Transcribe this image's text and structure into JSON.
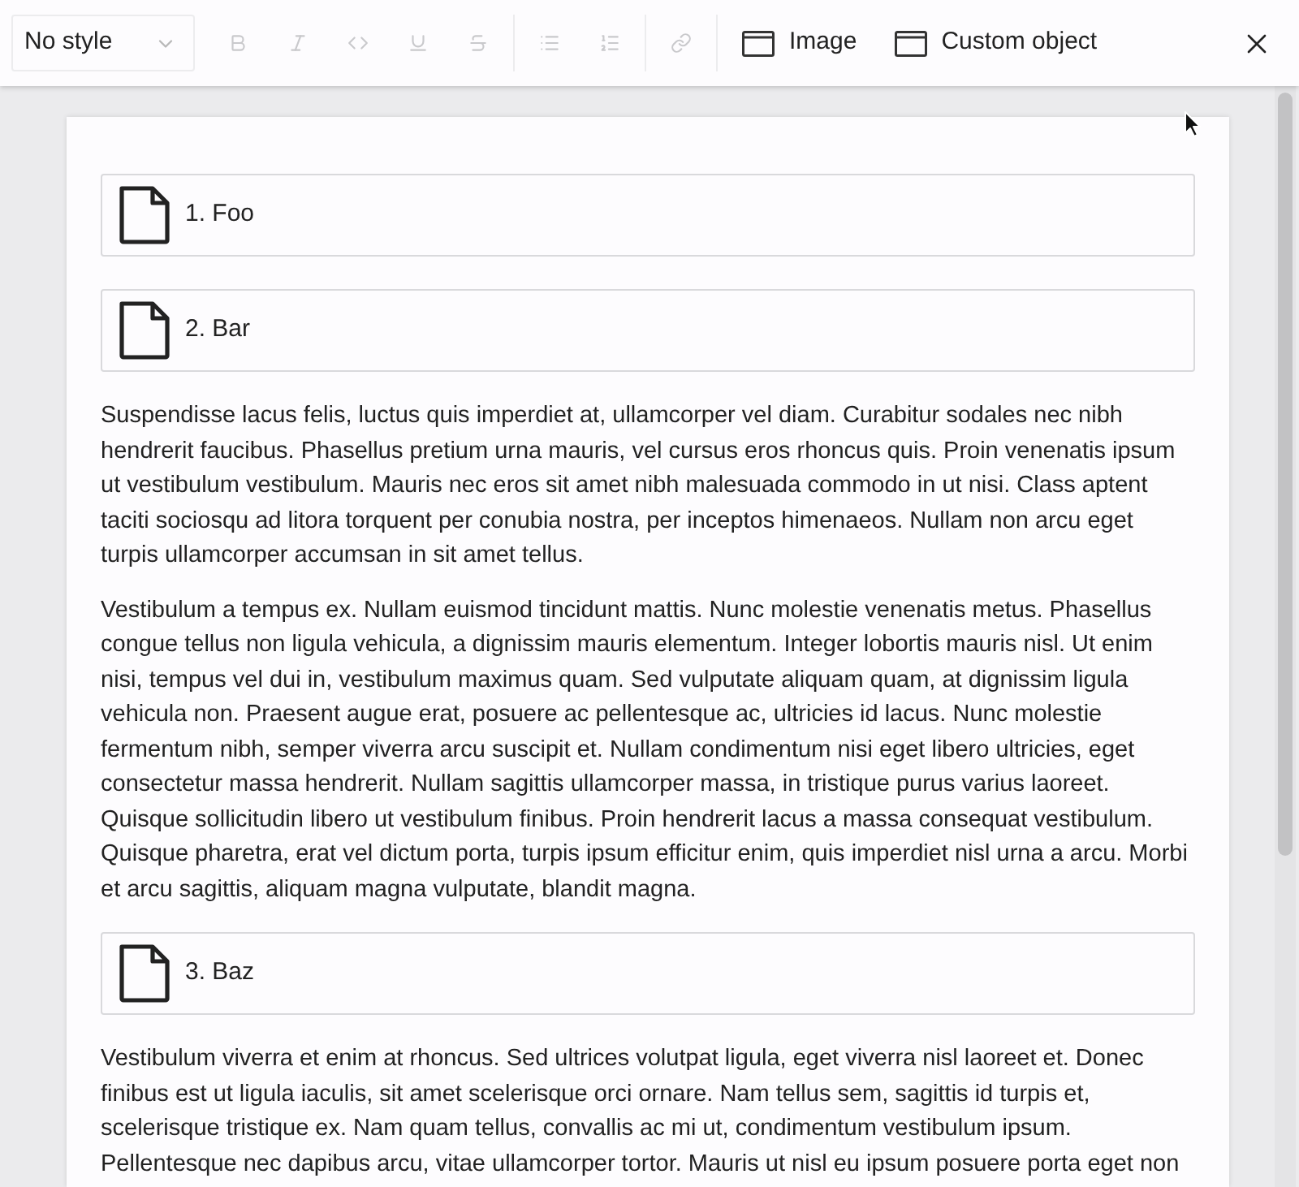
{
  "toolbar": {
    "style_dropdown": {
      "value": "No style"
    },
    "format_groups": [
      [
        {
          "kind": "bold",
          "disabled": true
        },
        {
          "kind": "italic",
          "disabled": true
        },
        {
          "kind": "code",
          "disabled": true
        },
        {
          "kind": "underline",
          "disabled": true
        },
        {
          "kind": "strikethrough",
          "disabled": true
        }
      ],
      [
        {
          "kind": "bulleted_list",
          "disabled": true
        },
        {
          "kind": "numbered_list",
          "disabled": true
        }
      ],
      [
        {
          "kind": "link",
          "disabled": true
        }
      ]
    ],
    "insert_buttons": [
      {
        "label": "Image"
      },
      {
        "label": "Custom object"
      }
    ]
  },
  "document": {
    "blocks": [
      {
        "kind": "object",
        "label": "1. Foo"
      },
      {
        "kind": "object",
        "label": "2. Bar"
      },
      {
        "kind": "paragraph",
        "text": "Suspendisse lacus felis, luctus quis imperdiet at, ullamcorper vel diam. Curabitur sodales nec nibh hendrerit faucibus. Phasellus pretium urna mauris, vel cursus eros rhoncus quis. Proin venenatis ipsum ut vestibulum vestibulum. Mauris nec eros sit amet nibh malesuada commodo in ut nisi. Class aptent taciti sociosqu ad litora torquent per conubia nostra, per inceptos himenaeos. Nullam non arcu eget turpis ullamcorper accumsan in sit amet tellus."
      },
      {
        "kind": "paragraph",
        "text": "Vestibulum a tempus ex. Nullam euismod tincidunt mattis. Nunc molestie venenatis metus. Phasellus congue tellus non ligula vehicula, a dignissim mauris elementum. Integer lobortis mauris nisl. Ut enim nisi, tempus vel dui in, vestibulum maximus quam. Sed vulputate aliquam quam, at dignissim ligula vehicula non. Praesent augue erat, posuere ac pellentesque ac, ultricies id lacus. Nunc molestie fermentum nibh, semper viverra arcu suscipit et. Nullam condimentum nisi eget libero ultricies, eget consectetur massa hendrerit. Nullam sagittis ullamcorper massa, in tristique purus varius laoreet. Quisque sollicitudin libero ut vestibulum finibus. Proin hendrerit lacus a massa consequat vestibulum. Quisque pharetra, erat vel dictum porta, turpis ipsum efficitur enim, quis imperdiet nisl urna a arcu. Morbi et arcu sagittis, aliquam magna vulputate, blandit magna."
      },
      {
        "kind": "object",
        "label": "3. Baz"
      },
      {
        "kind": "paragraph",
        "text": "Vestibulum viverra et enim at rhoncus. Sed ultrices volutpat ligula, eget viverra nisl laoreet et. Donec finibus est ut ligula iaculis, sit amet scelerisque orci ornare. Nam tellus sem, sagittis id turpis et, scelerisque tristique ex. Nam quam tellus, convallis ac mi ut, condimentum vestibulum ipsum. Pellentesque nec dapibus arcu, vitae ullamcorper tortor. Mauris ut nisl eu ipsum posuere porta eget non"
      }
    ]
  }
}
